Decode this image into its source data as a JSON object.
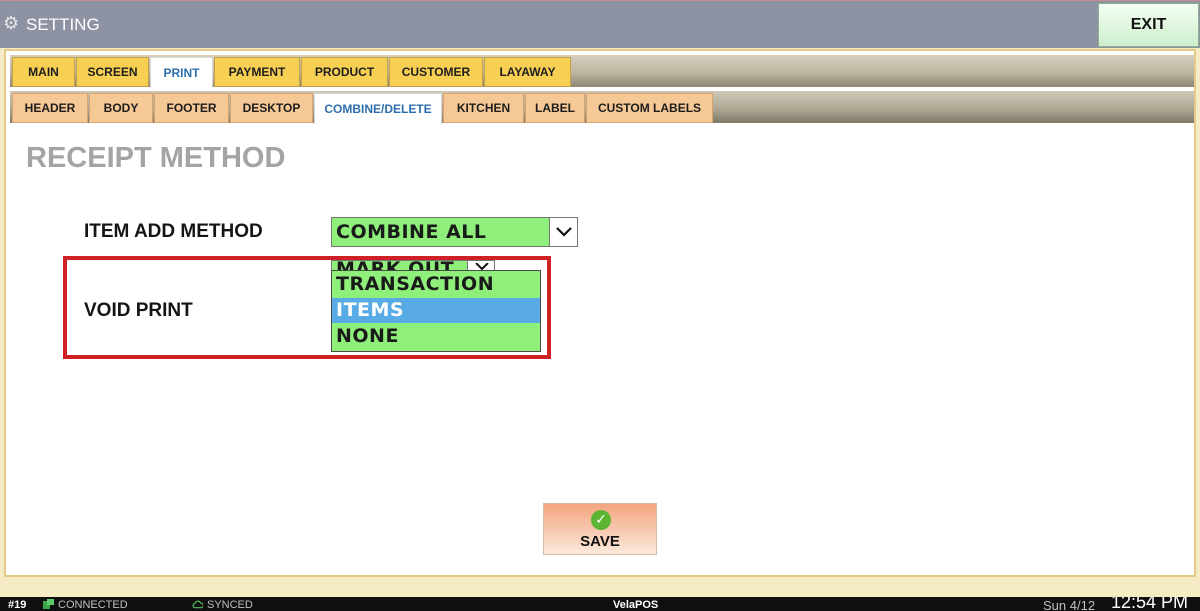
{
  "window": {
    "title": "SETTING",
    "exit_label": "EXIT"
  },
  "tabs_main": [
    "MAIN",
    "SCREEN",
    "PRINT",
    "PAYMENT",
    "PRODUCT",
    "CUSTOMER",
    "LAYAWAY"
  ],
  "tabs_main_active": "PRINT",
  "tabs_sub": [
    "HEADER",
    "BODY",
    "FOOTER",
    "DESKTOP",
    "COMBINE/DELETE",
    "KITCHEN",
    "LABEL",
    "CUSTOM LABELS"
  ],
  "tabs_sub_active": "COMBINE/DELETE",
  "section_title": "RECEIPT METHOD",
  "item_add": {
    "label": "ITEM ADD METHOD",
    "value": "COMBINE ALL"
  },
  "void_print": {
    "label": "VOID PRINT",
    "value": "MARK OUT",
    "options": [
      "TRANSACTION",
      "ITEMS",
      "NONE"
    ],
    "highlighted": "ITEMS"
  },
  "save_label": "SAVE",
  "statusbar": {
    "station": "#19",
    "connection": "CONNECTED",
    "sync": "SYNCED",
    "app_prefix": "Vela",
    "app_suffix": "POS",
    "date": "Sun 4/12",
    "time": "12:54 PM"
  },
  "colors": {
    "titlebar": "#8e93a4",
    "tab_main": "#f6cf53",
    "tab_sub": "#f6c895",
    "select_bg": "#8ef07a",
    "option_selected": "#58abe5",
    "highlight_border": "#cf2026",
    "active_tab_text": "#2d6fae"
  }
}
